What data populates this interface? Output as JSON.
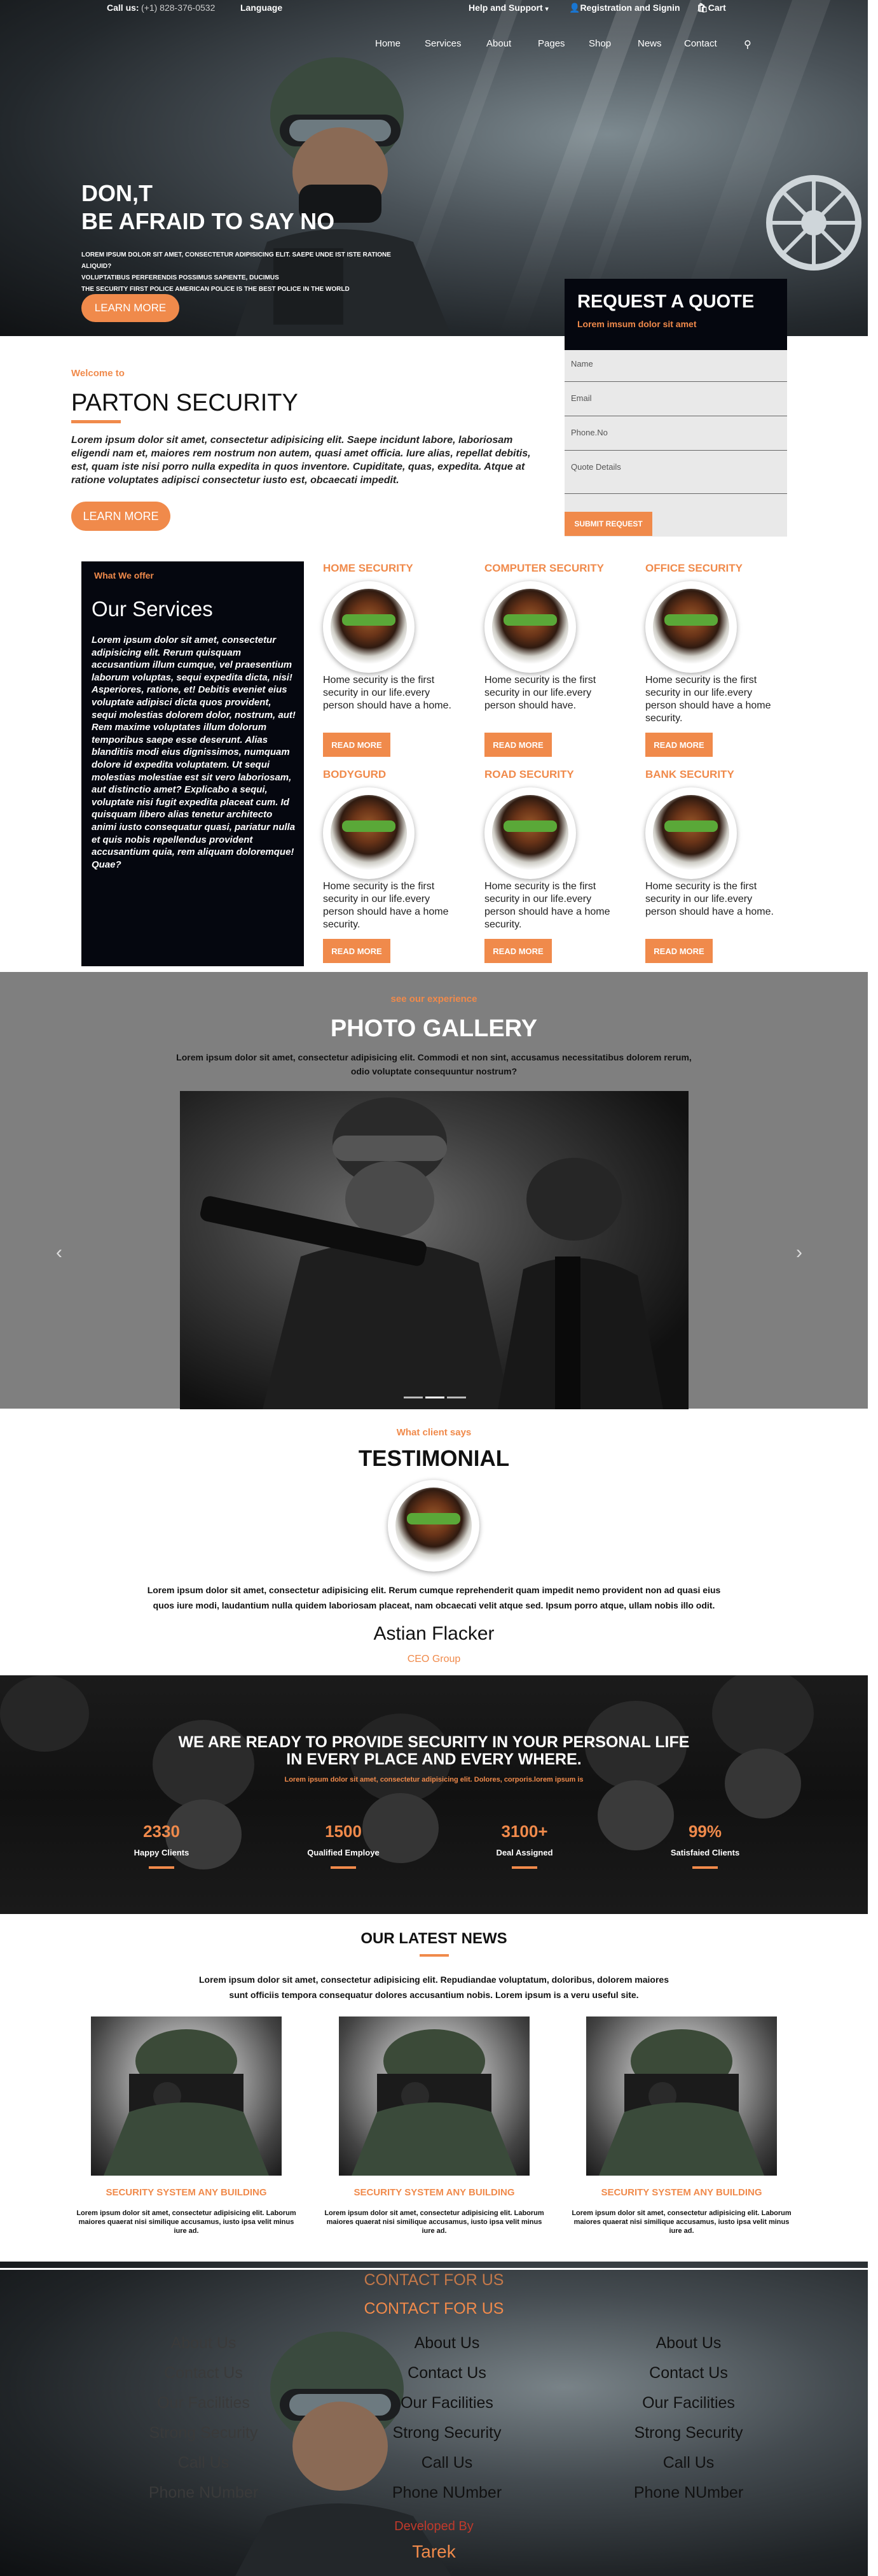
{
  "topbar": {
    "call": "Call us:",
    "phone": "(+1) 828-376-0532",
    "language": "Language",
    "help": "Help and Support",
    "register": "Registration and Signin",
    "cart": "Cart"
  },
  "nav": [
    "Home",
    "Services",
    "About",
    "Pages",
    "Shop",
    "News",
    "Contact"
  ],
  "hero": {
    "line1": "DON,T",
    "line2": "BE AFRAID TO SAY NO",
    "sub1": "LOREM IPSUM DOLOR SIT AMET, CONSECTETUR ADIPISICING ELIT. SAEPE UNDE IST ISTE RATIONE ALIQUID?",
    "sub2": "VOLUPTATIBUS PERFERENDIS POSSIMUS SAPIENTE, DUCIMUS",
    "sub3": "THE SECURITY FIRST POLICE AMERICAN POLICE IS THE BEST POLICE IN THE WORLD",
    "button": "LEARN MORE"
  },
  "quote": {
    "title": "REQUEST A QUOTE",
    "sub": "Lorem imsum dolor sit amet",
    "name": "Name",
    "email": "Email",
    "phone": "Phone.No",
    "details": "Quote Details",
    "button": "SUBMIT REQUEST"
  },
  "about": {
    "welcome": "Welcome to",
    "title": "PARTON SECURITY",
    "text": "Lorem ipsum dolor sit amet, consectetur adipisicing elit. Saepe incidunt labore, laboriosam eligendi nam et, maiores rem nostrum non autem, quasi amet officia. Iure alias, repellat debitis, est, quam iste nisi porro nulla expedita in quos inventore. Cupiditate, quas, expedita. Atque at ratione voluptates adipisci consectetur iusto est, obcaecati impedit.",
    "button": "LEARN MORE"
  },
  "services": {
    "offer": "What We offer",
    "title": "Our Services",
    "text": "Lorem ipsum dolor sit amet, consectetur adipisicing elit. Rerum quisquam accusantium illum cumque, vel praesentium laborum voluptas, sequi expedita dicta, nisi! Asperiores, ratione, et! Debitis eveniet eius voluptate adipisci dicta quos provident, sequi molestias dolorem dolor, nostrum, aut! Rem maxime voluptates illum dolorum temporibus saepe esse deserunt. Alias blanditiis modi eius dignissimos, numquam dolore id expedita voluptatem. Ut sequi molestias molestiae est sit vero laboriosam, aut distinctio amet? Explicabo a sequi, voluptate nisi fugit expedita placeat cum. Id quisquam libero alias tenetur architecto animi iusto consequatur quasi, pariatur nulla et quis nobis repellendus provident accusantium quia, rem aliquam doloremque! Quae?",
    "items": [
      {
        "title": "HOME SECURITY",
        "desc": "Home security is the first security in our life.every person should have a home.",
        "button": "READ MORE"
      },
      {
        "title": "COMPUTER SECURITY",
        "desc": "Home security is the first security in our life.every person should have.",
        "button": "READ MORE"
      },
      {
        "title": "OFFICE SECURITY",
        "desc": "Home security is the first security in our life.every person should have a home security.",
        "button": "READ MORE"
      },
      {
        "title": "BODYGURD",
        "desc": "Home security is the first security in our life.every person should have a home security.",
        "button": "READ MORE"
      },
      {
        "title": "ROAD SECURITY",
        "desc": "Home security is the first security in our life.every person should have a home security.",
        "button": "READ MORE"
      },
      {
        "title": "BANK SECURITY",
        "desc": "Home security is the first security in our life.every person should have a home.",
        "button": "READ MORE"
      }
    ]
  },
  "gallery": {
    "kicker": "see our experience",
    "title": "PHOTO GALLERY",
    "text1": "Lorem ipsum dolor sit amet, consectetur adipisicing elit. Commodi et non sint, accusamus necessitatibus dolorem rerum,",
    "text2": "odio voluptate consequuntur nostrum?"
  },
  "testimonial": {
    "kicker": "What client says",
    "title": "TESTIMONIAL",
    "text1": "Lorem ipsum dolor sit amet, consectetur adipisicing elit. Rerum cumque reprehenderit quam impedit nemo provident non ad quasi eius",
    "text2": "quos iure modi, laudantium nulla quidem laboriosam placeat, nam obcaecati velit atque sed. Ipsum porro atque, ullam nobis illo odit.",
    "name": "Astian Flacker",
    "role": "CEO Group"
  },
  "ready": {
    "line1": "WE ARE READY TO PROVIDE SECURITY IN YOUR PERSONAL LIFE",
    "line2": "IN EVERY PLACE AND EVERY WHERE.",
    "sub": "Lorem ipsum dolor sit amet, consectetur adipisicing elit. Dolores, corporis.lorem ipsum is",
    "stats": [
      {
        "n": "2330",
        "l": "Happy Clients"
      },
      {
        "n": "1500",
        "l": "Qualified Employe"
      },
      {
        "n": "3100+",
        "l": "Deal Assigned"
      },
      {
        "n": "99%",
        "l": "Satisfaied Clients"
      }
    ]
  },
  "news": {
    "title": "OUR LATEST NEWS",
    "text1": "Lorem ipsum dolor sit amet, consectetur adipisicing elit. Repudiandae voluptatum, doloribus, dolorem maiores",
    "text2": "sunt officiis tempora consequatur dolores accusantium nobis. Lorem ipsum is a veru useful site.",
    "items": [
      {
        "title": "SECURITY SYSTEM ANY BUILDING",
        "desc1": "Lorem ipsum dolor sit amet, consectetur adipisicing elit. Laborum",
        "desc2": "maiores quaerat nisi similique accusamus, iusto ipsa velit minus iure ad."
      },
      {
        "title": "SECURITY SYSTEM ANY BUILDING",
        "desc1": "Lorem ipsum dolor sit amet, consectetur adipisicing elit. Laborum",
        "desc2": "maiores quaerat nisi similique accusamus, iusto ipsa velit minus iure ad."
      },
      {
        "title": "SECURITY SYSTEM ANY BUILDING",
        "desc1": "Lorem ipsum dolor sit amet, consectetur adipisicing elit. Laborum",
        "desc2": "maiores quaerat nisi similique accusamus, iusto ipsa velit minus iure ad."
      }
    ]
  },
  "footer": {
    "contact": "CONTACT FOR US",
    "links": [
      "About Us",
      "Contact Us",
      "Our Facilities",
      "Strong Security",
      "Call Us",
      "Phone NUmber"
    ],
    "dev": "Developed By",
    "author": "Tarek"
  },
  "colors": {
    "accent": "#f08a4b",
    "dark": "#05070f",
    "gallery_bg": "#7f7f7f"
  }
}
